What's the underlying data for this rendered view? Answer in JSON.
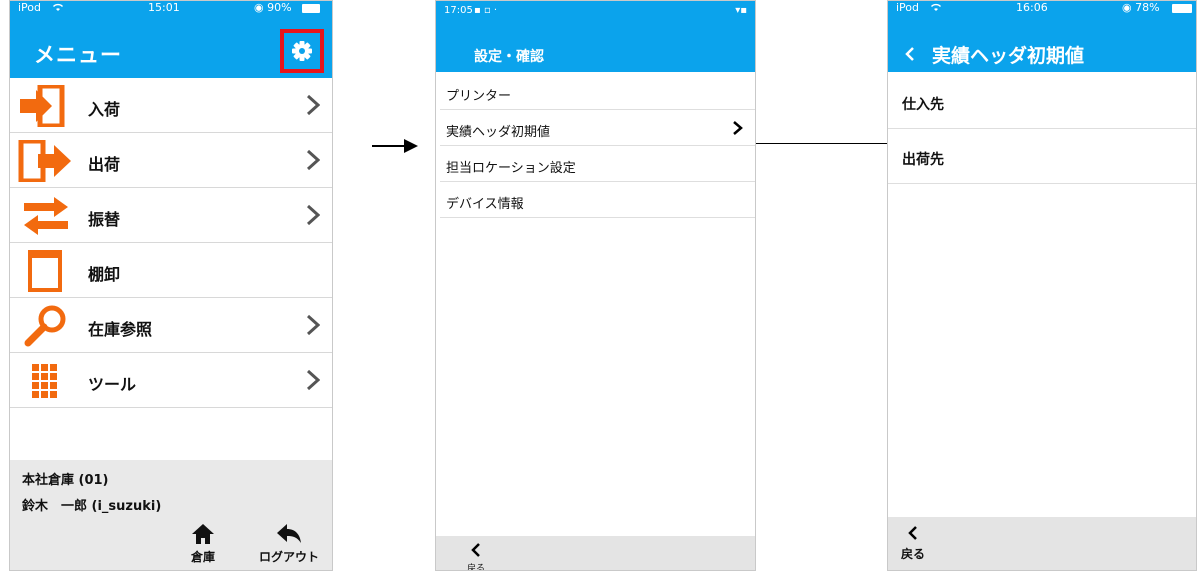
{
  "phone1": {
    "status": {
      "carrier": "iPod",
      "time": "15:01",
      "battery": "◉ 90%"
    },
    "title": "メニュー",
    "menu": [
      {
        "label": "入荷",
        "icon": "inbound-arrow-icon"
      },
      {
        "label": "出荷",
        "icon": "outbound-arrow-icon"
      },
      {
        "label": "振替",
        "icon": "transfer-arrows-icon"
      },
      {
        "label": "棚卸",
        "icon": "inventory-frame-icon"
      },
      {
        "label": "在庫参照",
        "icon": "magnifier-icon"
      },
      {
        "label": "ツール",
        "icon": "grid-icon"
      }
    ],
    "warehouse": "本社倉庫 (01)",
    "user": "鈴木　一郎 (i_suzuki)",
    "toolbar": {
      "warehouse_label": "倉庫",
      "logout_label": "ログアウト"
    }
  },
  "phone2": {
    "status": {
      "time": "17:05"
    },
    "title": "設定・確認",
    "items": [
      {
        "label": "プリンター"
      },
      {
        "label": "実績ヘッダ初期値"
      },
      {
        "label": "担当ロケーション設定"
      },
      {
        "label": "デバイス情報"
      }
    ],
    "back_label": "戻る"
  },
  "phone3": {
    "status": {
      "carrier": "iPod",
      "time": "16:06",
      "battery": "◉ 78%"
    },
    "title": "実績ヘッダ初期値",
    "items": [
      {
        "label": "仕入先"
      },
      {
        "label": "出荷先"
      }
    ],
    "back_label": "戻る"
  },
  "colors": {
    "header": "#0ba3ec",
    "accent": "#f26a0f",
    "highlight": "#e8141a"
  }
}
